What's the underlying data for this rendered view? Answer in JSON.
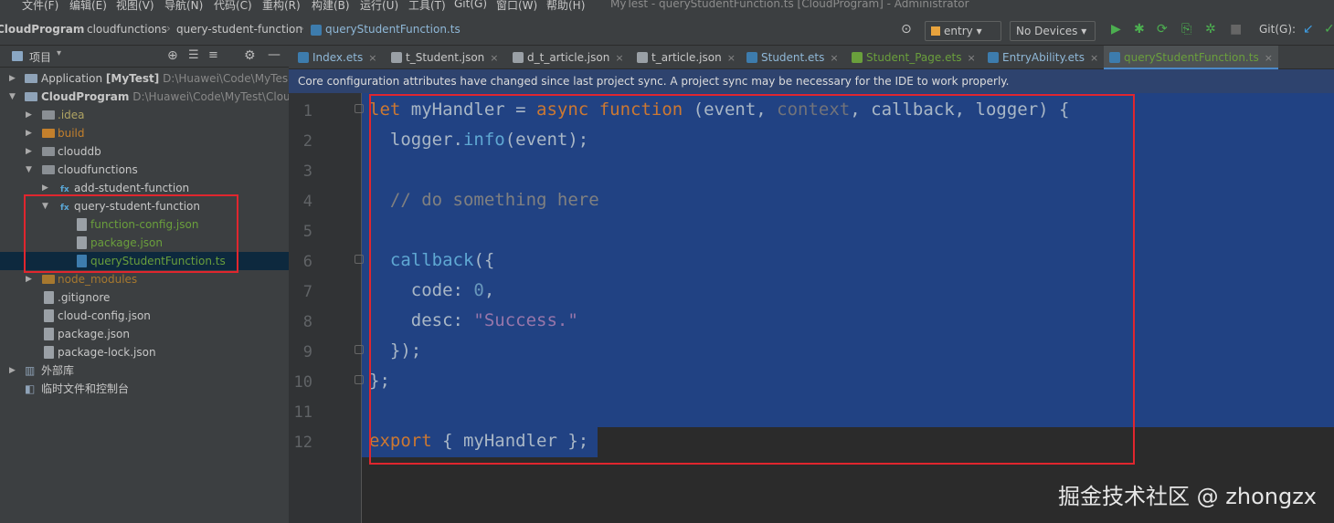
{
  "menu": {
    "items": [
      "文件(F)",
      "编辑(E)",
      "视图(V)",
      "导航(N)",
      "代码(C)",
      "重构(R)",
      "构建(B)",
      "运行(U)",
      "工具(T)",
      "Git(G)",
      "窗口(W)",
      "帮助(H)"
    ],
    "window_title": "MyTest - queryStudentFunction.ts [CloudProgram] - Administrator"
  },
  "breadcrumb": [
    "CloudProgram",
    "cloudfunctions",
    "query-student-function",
    "queryStudentFunction.ts"
  ],
  "toolbar": {
    "run_config": "entry",
    "device": "No Devices",
    "git_label": "Git(G):"
  },
  "project_panel": {
    "title": "项目",
    "tree": [
      {
        "label": "Application",
        "bold_suffix": "[MyTest]",
        "path": "D:\\Huawei\\Code\\MyTes"
      },
      {
        "label": "CloudProgram",
        "path": "D:\\Huawei\\Code\\MyTest\\Clou"
      },
      {
        "label": ".idea"
      },
      {
        "label": "build"
      },
      {
        "label": "clouddb"
      },
      {
        "label": "cloudfunctions"
      },
      {
        "label": "add-student-function"
      },
      {
        "label": "query-student-function"
      },
      {
        "label": "function-config.json"
      },
      {
        "label": "package.json"
      },
      {
        "label": "queryStudentFunction.ts"
      },
      {
        "label": "node_modules"
      },
      {
        "label": ".gitignore"
      },
      {
        "label": "cloud-config.json"
      },
      {
        "label": "package.json"
      },
      {
        "label": "package-lock.json"
      },
      {
        "label": "外部库"
      },
      {
        "label": "临时文件和控制台"
      }
    ]
  },
  "tabs": [
    "Index.ets",
    "t_Student.json",
    "d_t_article.json",
    "t_article.json",
    "Student.ets",
    "Student_Page.ets",
    "EntryAbility.ets",
    "queryStudentFunction.ts"
  ],
  "banner": "Core configuration attributes have changed since last project sync. A project sync may be necessary for the IDE to work properly.",
  "editor": {
    "line_numbers": [
      "1",
      "2",
      "3",
      "4",
      "5",
      "6",
      "7",
      "8",
      "9",
      "10",
      "11",
      "12"
    ],
    "code": {
      "l1": {
        "let": "let",
        "name": " myHandler = ",
        "async": "async",
        "sp": " ",
        "function": "function",
        "params_a": " (event, ",
        "context": "context",
        "params_b": ", callback, logger) {"
      },
      "l2": {
        "a": "  logger.",
        "info": "info",
        "b": "(event);"
      },
      "l4": "  // do something here",
      "l6": {
        "callback": "  callback",
        "b": "({"
      },
      "l7": {
        "key": "    code: ",
        "val": "0",
        "end": ","
      },
      "l8": {
        "key": "    desc: ",
        "val": "\"Success.\""
      },
      "l9": "  });",
      "l10": "};",
      "l12": {
        "export": "export",
        "rest": " { myHandler };"
      }
    }
  },
  "watermark": "掘金技术社区 @ zhongzx"
}
